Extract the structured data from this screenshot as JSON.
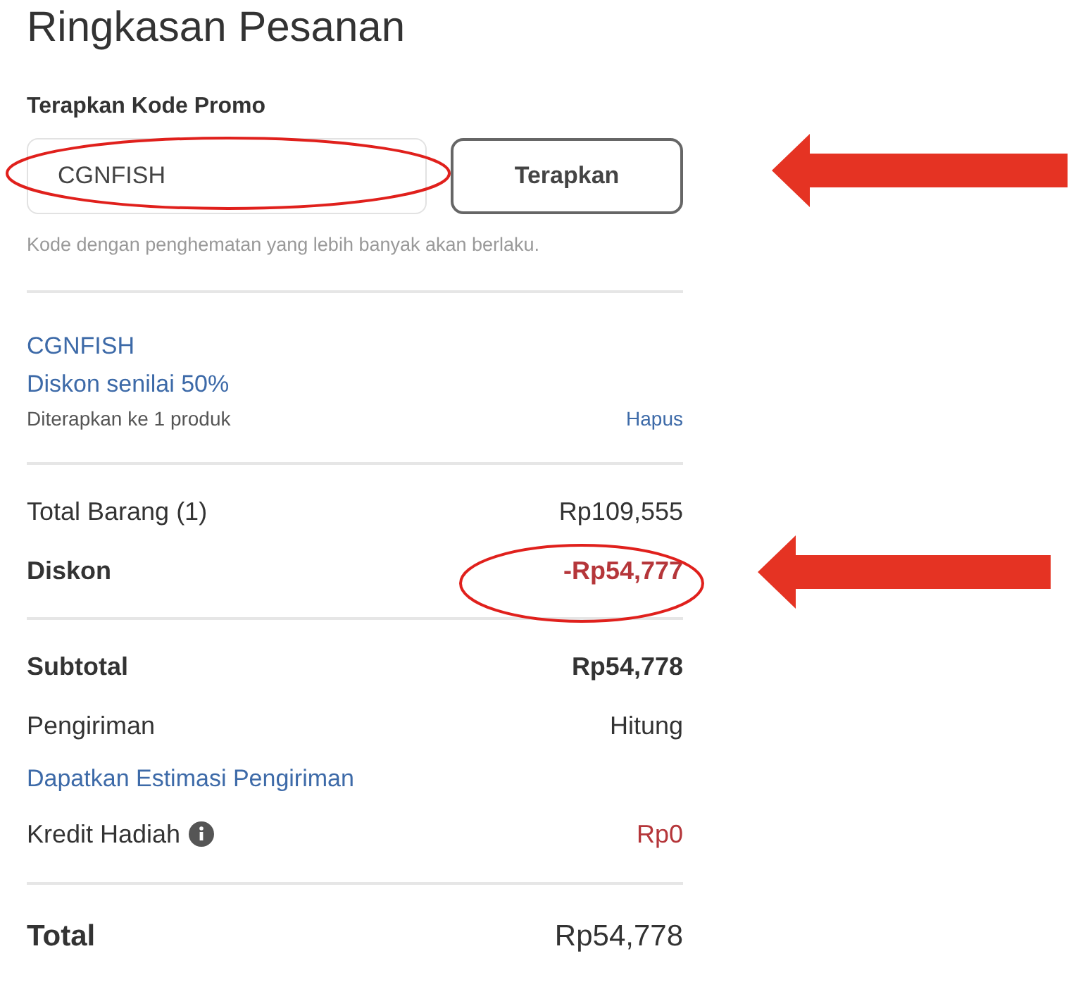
{
  "title": "Ringkasan Pesanan",
  "promo": {
    "label": "Terapkan Kode Promo",
    "value": "CGNFISH",
    "button": "Terapkan",
    "hint": "Kode dengan penghematan yang lebih banyak akan berlaku."
  },
  "applied_promo": {
    "code": "CGNFISH",
    "description": "Diskon senilai 50%",
    "note": "Diterapkan ke 1 produk",
    "remove_link": "Hapus"
  },
  "sections": [
    {
      "rows": [
        {
          "kind": "row",
          "label": "Total Barang (1)",
          "value": "Rp109,555",
          "bold": false,
          "red": false
        },
        {
          "kind": "row",
          "label": "Diskon",
          "value": "-Rp54,777",
          "bold": true,
          "red": true
        }
      ]
    },
    {
      "rows": [
        {
          "kind": "row",
          "label": "Subtotal",
          "value": "Rp54,778",
          "bold": true,
          "red": false
        },
        {
          "kind": "row",
          "label": "Pengiriman",
          "value": "Hitung",
          "bold": false,
          "red": false
        },
        {
          "kind": "link",
          "label": "Dapatkan Estimasi Pengiriman"
        },
        {
          "kind": "info",
          "label": "Kredit Hadiah",
          "value": "Rp0",
          "bold": false,
          "red": true
        }
      ]
    },
    {
      "rows": [
        {
          "kind": "total",
          "label": "Total",
          "value": "Rp54,778",
          "bold": false,
          "red": false
        }
      ]
    }
  ]
}
